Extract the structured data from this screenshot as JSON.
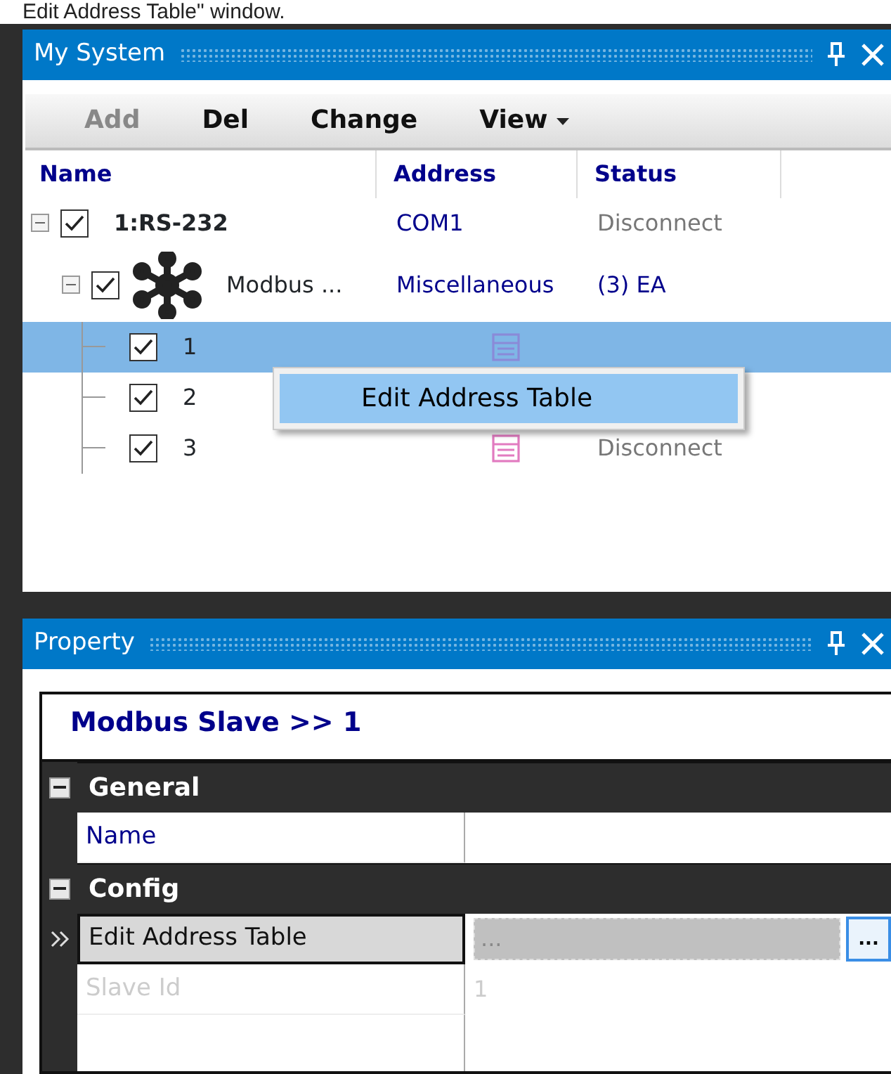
{
  "caption": "Edit Address Table\" window.",
  "my_system": {
    "title": "My System",
    "toolbar": [
      {
        "label": "Add",
        "disabled": true,
        "kind": "button"
      },
      {
        "label": "Del",
        "disabled": false,
        "kind": "button"
      },
      {
        "label": "Change",
        "disabled": false,
        "kind": "button"
      },
      {
        "label": "View",
        "disabled": false,
        "kind": "dropdown"
      }
    ],
    "columns": [
      "Name",
      "Address",
      "Status"
    ],
    "tree": [
      {
        "kind": "port",
        "name": "1:RS-232",
        "address": "COM1",
        "status": "Disconnect",
        "checked": true,
        "expanded": true,
        "selected": false,
        "children": [
          {
            "kind": "device",
            "name": "Modbus ...",
            "address": "Miscellaneous",
            "status": "(3) EA",
            "checked": true,
            "expanded": true,
            "selected": false,
            "children": [
              {
                "kind": "slave",
                "name": "1",
                "checked": true,
                "selected": true
              },
              {
                "kind": "slave",
                "name": "2",
                "checked": true,
                "selected": false
              },
              {
                "kind": "slave",
                "name": "3",
                "status": "Disconnect",
                "checked": true,
                "selected": false
              }
            ]
          }
        ]
      }
    ],
    "context_menu": [
      {
        "label": "Edit Address Table",
        "selected": true
      }
    ]
  },
  "property": {
    "title": "Property",
    "header": "Modbus Slave >> 1",
    "sections": [
      {
        "name": "General",
        "expanded": true,
        "rows": [
          {
            "name": "Name",
            "selected": false,
            "disabled": false
          }
        ]
      },
      {
        "name": "Config",
        "expanded": true,
        "rows": [
          {
            "name": "Edit Address Table",
            "value": "...",
            "button": "...",
            "selected": true,
            "disabled": false
          },
          {
            "name": "Slave Id",
            "value": "1",
            "selected": false,
            "disabled": true
          }
        ]
      }
    ]
  }
}
